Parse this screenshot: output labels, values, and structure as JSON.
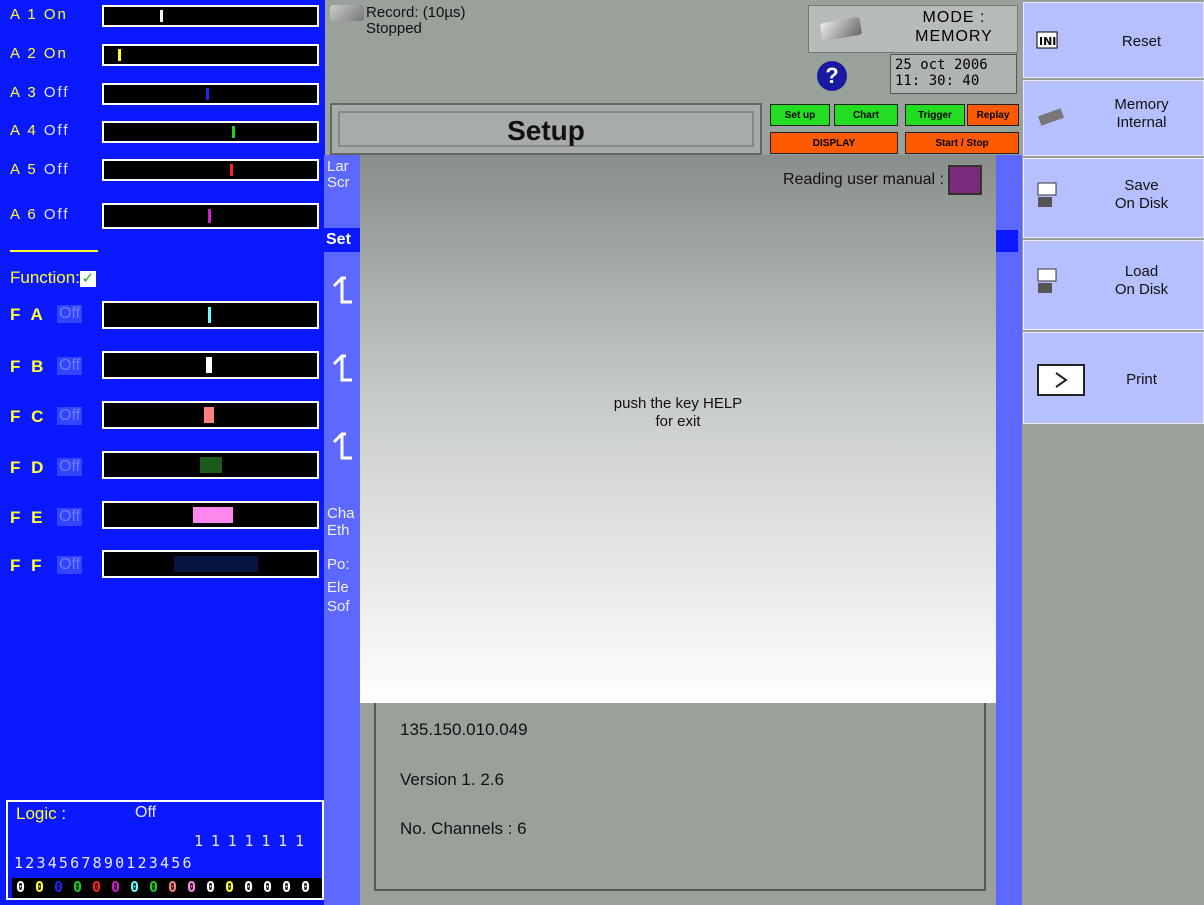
{
  "analog_channels": [
    {
      "label": "A 1",
      "state": "On"
    },
    {
      "label": "A 2",
      "state": "On"
    },
    {
      "label": "A 3",
      "state": "Off"
    },
    {
      "label": "A 4",
      "state": "Off"
    },
    {
      "label": "A 5",
      "state": "Off"
    },
    {
      "label": "A 6",
      "state": "Off"
    }
  ],
  "function": {
    "label": "Function:",
    "check": "✓"
  },
  "function_channels": [
    {
      "label": "F A",
      "state": "Off"
    },
    {
      "label": "F B",
      "state": "Off"
    },
    {
      "label": "F C",
      "state": "Off"
    },
    {
      "label": "F D",
      "state": "Off"
    },
    {
      "label": "F E",
      "state": "Off"
    },
    {
      "label": "F F",
      "state": "Off"
    }
  ],
  "logic": {
    "title": "Logic :",
    "state": "Off",
    "row1": "1111111",
    "row2": "1234567890123456",
    "values": [
      "0",
      "0",
      "0",
      "0",
      "0",
      "0",
      "0",
      "0",
      "0",
      "0",
      "0",
      "0",
      "0",
      "0",
      "0",
      "0"
    ]
  },
  "status": {
    "line1": "Record: (10µs)",
    "line2": "Stopped"
  },
  "mode": {
    "line1": "MODE :",
    "line2": "MEMORY"
  },
  "help_icon": "?",
  "date": {
    "line1": "25 oct 2006",
    "line2": "11: 30: 40"
  },
  "page_title": "Setup",
  "top_buttons": {
    "setup": "Set up",
    "chart": "Chart",
    "trigger": "Trigger",
    "replay": "Replay",
    "display": "DISPLAY",
    "start_stop": "Start / Stop"
  },
  "background_fragments": {
    "lan": "Lar",
    "scr": "Scr",
    "sel": "Set",
    "cha": "Cha",
    "eth": "Eth",
    "pos": "Po:",
    "ele": "Ele",
    "sof": "Sof"
  },
  "overlay": {
    "manual_label": "Reading user manual :",
    "message_line1": "push the key HELP",
    "message_line2": "for exit"
  },
  "info": {
    "ip": "135.150.010.049",
    "version": "Version 1. 2.6",
    "channels": "No. Channels : 6"
  },
  "menu": {
    "reset": "Reset",
    "memory_line1": "Memory",
    "memory_line2": "Internal",
    "save_line1": "Save",
    "save_line2": "On Disk",
    "load_line1": "Load",
    "load_line2": "On Disk",
    "print": "Print"
  },
  "colors": {
    "panel_blue": "#0a19ff",
    "channel_label": "#ffff33",
    "green_button": "#22dd22",
    "orange_button": "#ff5a00"
  }
}
